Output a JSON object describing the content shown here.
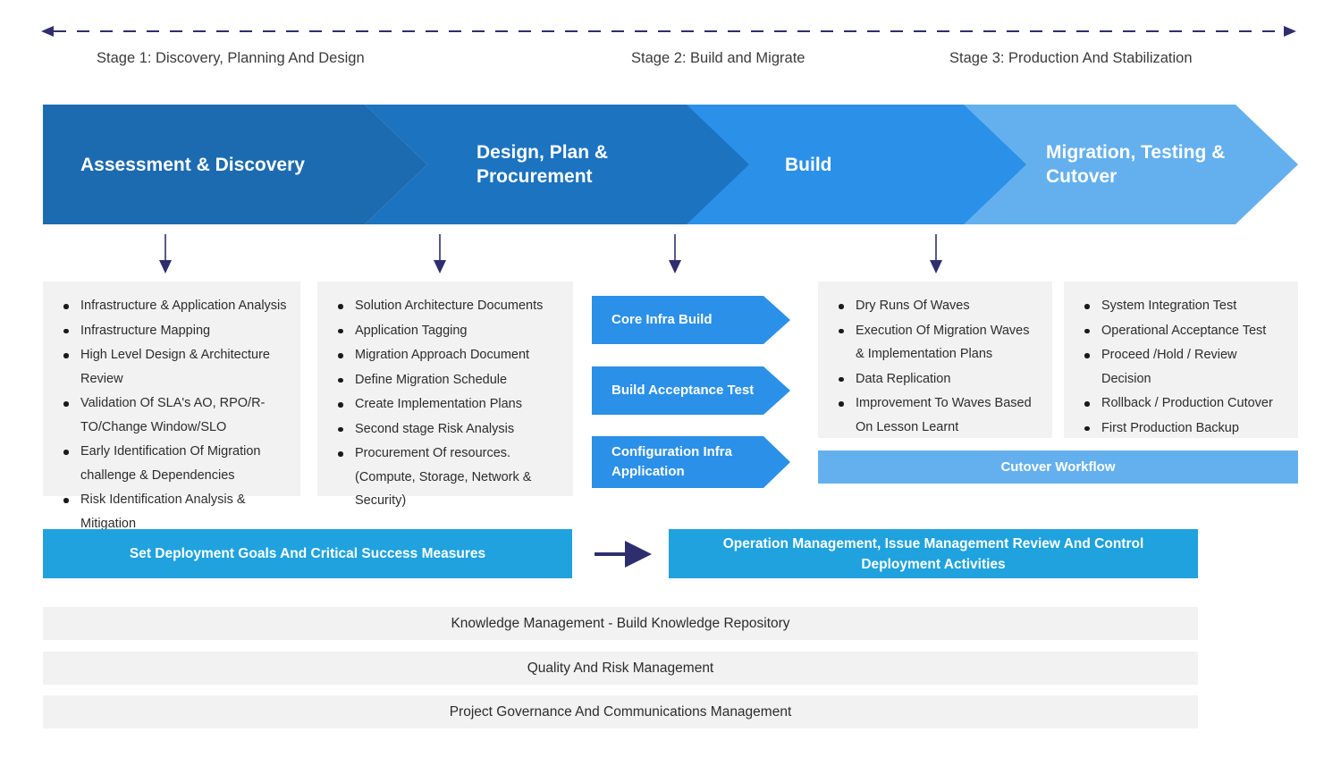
{
  "timeline": {
    "arrow_color": "#2E2E6E",
    "stages": [
      {
        "label": "Stage 1: Discovery, Planning\nAnd Design"
      },
      {
        "label": "Stage 2: Build and Migrate"
      },
      {
        "label": "Stage 3: Production And Stabilization"
      }
    ]
  },
  "banner": {
    "phases": [
      {
        "label": "Assessment & Discovery",
        "color": "#1C6BB0"
      },
      {
        "label": "Design, Plan &\nProcurement",
        "color": "#1C73C0"
      },
      {
        "label": "Build",
        "color": "#2B90E8"
      },
      {
        "label": "Migration, Testing &\nCutover",
        "color": "#64B0EE"
      }
    ]
  },
  "columns": {
    "assessment_discovery": {
      "bullets": [
        "Infrastructure & Application Analysis",
        "Infrastructure Mapping",
        "High Level Design & Architecture Review",
        "Validation Of SLA's AO, RPO/R-TO/Change Window/SLO",
        "Early Identification Of Migration challenge & Dependencies",
        "Risk Identification Analysis & Mitigation"
      ]
    },
    "design_plan_procurement": {
      "bullets": [
        "Solution Architecture Documents",
        "Application Tagging",
        "Migration Approach Document",
        "Define Migration Schedule",
        "Create Implementation Plans",
        "Second stage Risk Analysis",
        "Procurement Of resources. (Compute, Storage, Network & Security)"
      ]
    },
    "build": {
      "tags": [
        {
          "label": "Core Infra Build"
        },
        {
          "label": "Build Acceptance Test"
        },
        {
          "label": "Configuration Infra Application"
        }
      ]
    },
    "migration": {
      "bullets": [
        "Dry Runs Of Waves",
        "Execution Of Migration Waves & Implementation Plans",
        "Data Replication",
        "Improvement To Waves Based On Lesson Learnt"
      ]
    },
    "testing_cutover": {
      "bullets": [
        "System Integration Test",
        "Operational Acceptance Test",
        "Proceed /Hold / Review Decision",
        "Rollback / Production Cutover",
        "First Production Backup"
      ]
    },
    "cutover_workflow": {
      "label": "Cutover Workflow",
      "color": "#64B0EE"
    }
  },
  "mid_section": {
    "left_bar": {
      "label": "Set Deployment Goals And Critical Success Measures",
      "color": "#1FA2DE"
    },
    "right_bar": {
      "label": "Operation Management, Issue Management Review And Control Deployment Activities",
      "color": "#1FA2DE"
    },
    "arrow_color": "#2E2E6E"
  },
  "footer_bars": [
    {
      "label": "Knowledge Management - Build Knowledge Repository"
    },
    {
      "label": "Quality And Risk Management"
    },
    {
      "label": "Project Governance And Communications Management"
    }
  ]
}
